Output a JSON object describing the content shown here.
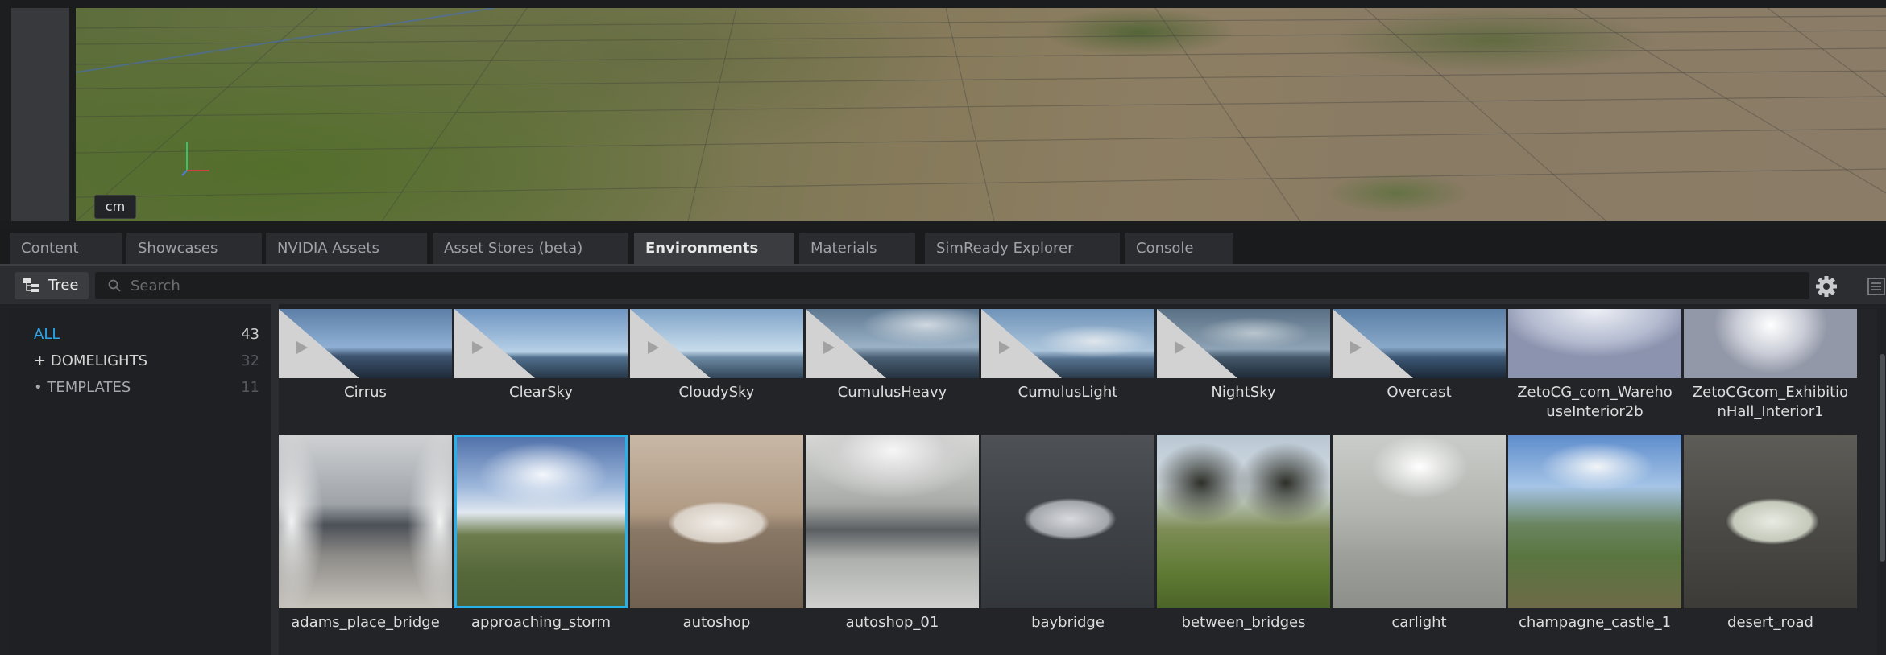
{
  "viewport": {
    "unit_badge": "cm"
  },
  "tabs": [
    {
      "label": "Content",
      "active": false
    },
    {
      "label": "Showcases",
      "active": false
    },
    {
      "label": "NVIDIA Assets",
      "active": false
    },
    {
      "label": "Asset Stores (beta)",
      "active": false
    },
    {
      "label": "Environments",
      "active": true
    },
    {
      "label": "Materials",
      "active": false
    },
    {
      "label": "SimReady Explorer",
      "active": false
    },
    {
      "label": "Console",
      "active": false
    }
  ],
  "toolbar": {
    "tree_label": "Tree",
    "tree_icon": "tree-icon",
    "search_placeholder": "Search",
    "search_value": "",
    "gear_icon": "gear-icon",
    "list_icon": "list-view-icon"
  },
  "categories": [
    {
      "prefix": "",
      "label": "ALL",
      "count": "43"
    },
    {
      "prefix": "+",
      "label": "DOMELIGHTS",
      "count": "32"
    },
    {
      "prefix": "•",
      "label": "TEMPLATES",
      "count": "11"
    }
  ],
  "assets_row1": [
    {
      "name": "Cirrus"
    },
    {
      "name": "ClearSky"
    },
    {
      "name": "CloudySky"
    },
    {
      "name": "CumulusHeavy"
    },
    {
      "name": "CumulusLight"
    },
    {
      "name": "NightSky"
    },
    {
      "name": "Overcast"
    },
    {
      "name": "ZetoCG_com_Wareho\nuseInterior2b"
    },
    {
      "name": "ZetoCGcom_Exhibitio\nnHall_Interior1"
    }
  ],
  "assets_row2": [
    {
      "name": "adams_place_bridge"
    },
    {
      "name": "approaching_storm",
      "selected": true
    },
    {
      "name": "autoshop"
    },
    {
      "name": "autoshop_01"
    },
    {
      "name": "baybridge"
    },
    {
      "name": "between_bridges"
    },
    {
      "name": "carlight"
    },
    {
      "name": "champagne_castle_1"
    },
    {
      "name": "desert_road"
    }
  ],
  "colors": {
    "accent": "#2ea6e8",
    "selection": "#27b0ea",
    "panel_bg": "#222428",
    "tab_active": "#3a3c3f"
  }
}
